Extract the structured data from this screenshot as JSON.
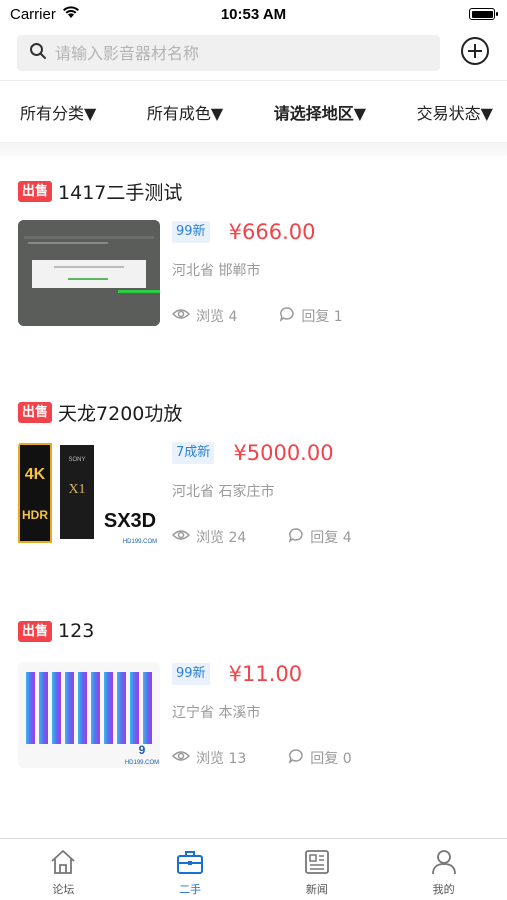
{
  "status_bar": {
    "carrier": "Carrier",
    "time": "10:53 AM"
  },
  "search": {
    "placeholder": "请输入影音器材名称"
  },
  "filters": [
    {
      "label": "所有分类▼"
    },
    {
      "label": "所有成色▼"
    },
    {
      "label": "请选择地区▼"
    },
    {
      "label": "交易状态▼"
    }
  ],
  "listings": [
    {
      "badge": "出售",
      "title": "1417二手测试",
      "condition": "99新",
      "price": "¥666.00",
      "location": "河北省 邯郸市",
      "views": "浏览 4",
      "replies": "回复 1",
      "thumb_icon": "screenshot-thumb-icon"
    },
    {
      "badge": "出售",
      "title": "天龙7200功放",
      "condition": "7成新",
      "price": "¥5000.00",
      "location": "河北省 石家庄市",
      "views": "浏览 24",
      "replies": "回复 4",
      "thumb_text": {
        "line1": "4K",
        "line2": "HDR",
        "brand": "SX3D",
        "sub": "HD199.COM",
        "sony": "SONY",
        "x1": "X1"
      }
    },
    {
      "badge": "出售",
      "title": "123",
      "condition": "99新",
      "price": "¥11.00",
      "location": "辽宁省 本溪市",
      "views": "浏览 13",
      "replies": "回复 0",
      "thumb_text": {
        "sub": "HD199.COM"
      }
    }
  ],
  "tabs": [
    {
      "label": "论坛",
      "icon": "home-icon"
    },
    {
      "label": "二手",
      "icon": "briefcase-icon"
    },
    {
      "label": "新闻",
      "icon": "newspaper-icon"
    },
    {
      "label": "我的",
      "icon": "user-icon"
    }
  ],
  "colors": {
    "accent": "#1a6fd6",
    "price": "#f0434b",
    "sale_badge": "#f2434b"
  }
}
